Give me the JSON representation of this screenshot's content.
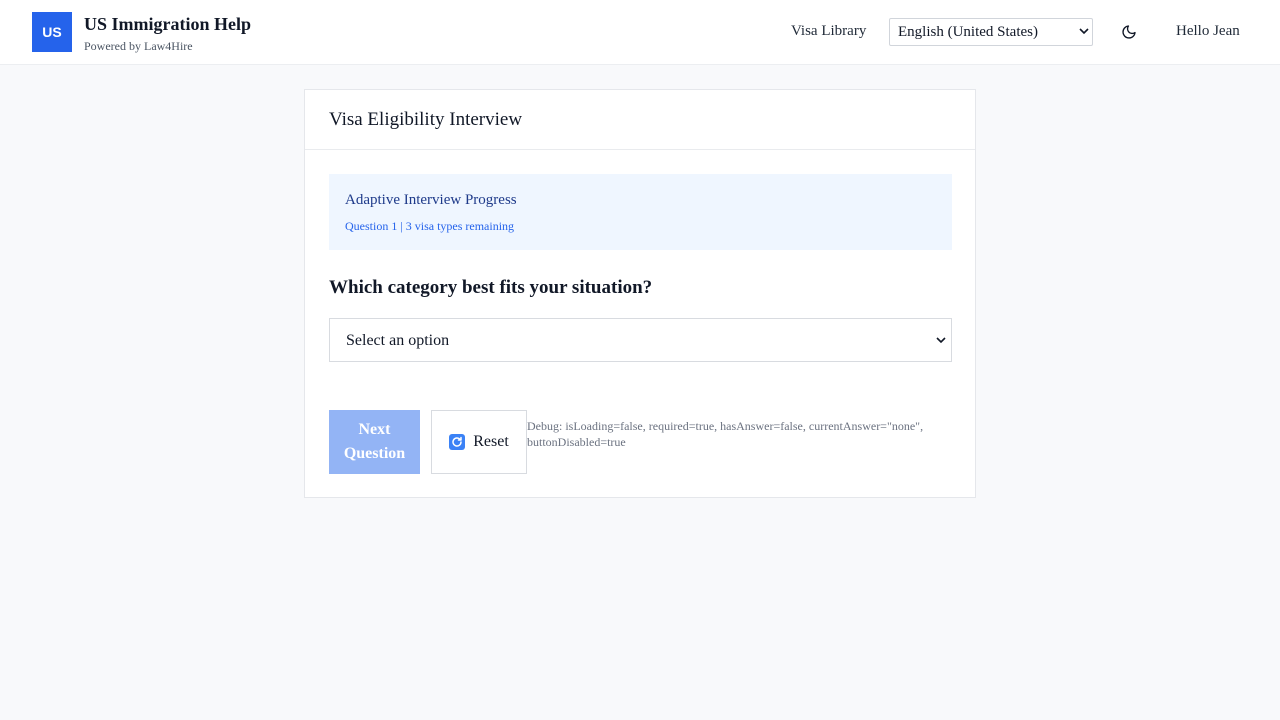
{
  "header": {
    "logo_text": "US",
    "title": "US Immigration Help",
    "subtitle": "Powered by Law4Hire",
    "nav_link": "Visa Library",
    "language": {
      "selected": "English (United States)",
      "options": [
        "English (United States)"
      ]
    },
    "theme_icon": "moon-icon",
    "greeting": "Hello Jean"
  },
  "card": {
    "title": "Visa Eligibility Interview",
    "progress": {
      "title": "Adaptive Interview Progress",
      "status": "Question 1 | 3 visa types remaining"
    },
    "question": "Which category best fits your situation?",
    "answer": {
      "placeholder": "Select an option",
      "options": [
        "Select an option"
      ]
    },
    "buttons": {
      "next_label": "Next Question",
      "reset_label": "Reset",
      "reset_icon": "refresh-icon"
    },
    "debug_text": "Debug: isLoading=false, required=true, hasAnswer=false, currentAnswer=\"none\", buttonDisabled=true"
  },
  "colors": {
    "primary": "#2563eb",
    "primary_disabled": "#93b4f5",
    "progress_bg": "#eff6ff",
    "page_bg": "#f8f9fb"
  }
}
